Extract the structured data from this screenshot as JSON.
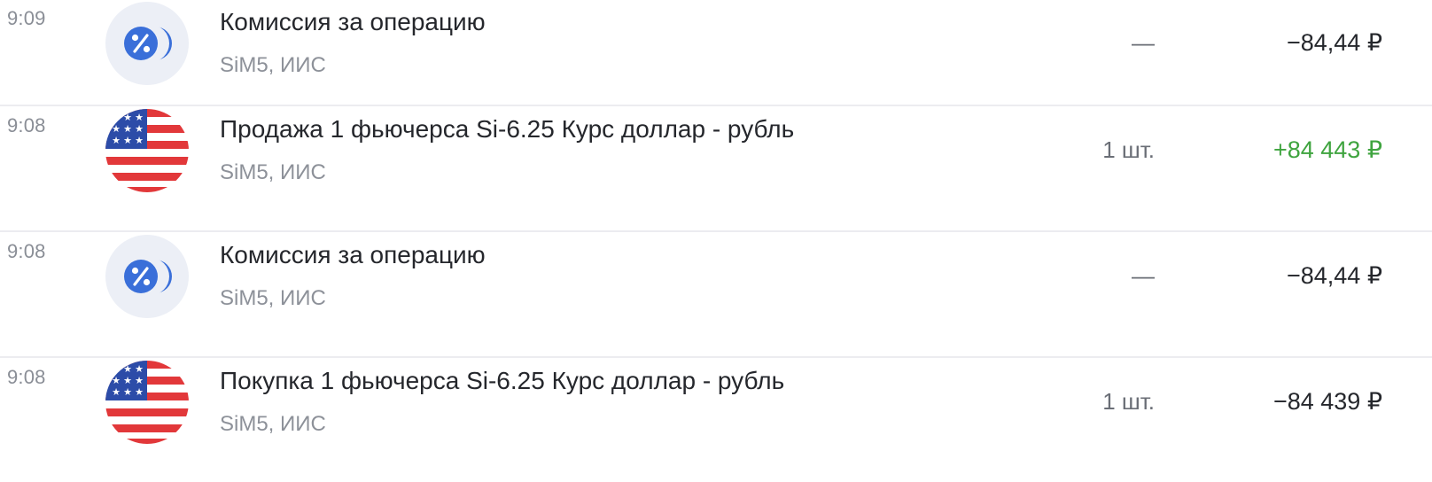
{
  "colors": {
    "positive_amount": "#3fa43f",
    "commission_icon": "#3a6fd9",
    "divider": "#ececf0"
  },
  "operations": [
    {
      "time": "9:09",
      "icon": "percent-coin-icon",
      "title": "Комиссия за операцию",
      "subtitle": "SiM5, ИИС",
      "quantity": "—",
      "amount": "−84,44 ₽"
    },
    {
      "time": "9:08",
      "icon": "us-flag-icon",
      "title": "Продажа 1 фьючерса Si-6.25 Курс доллар - рубль",
      "subtitle": "SiM5, ИИС",
      "quantity": "1 шт.",
      "amount": "+84 443 ₽"
    },
    {
      "time": "9:08",
      "icon": "percent-coin-icon",
      "title": "Комиссия за операцию",
      "subtitle": "SiM5, ИИС",
      "quantity": "—",
      "amount": "−84,44 ₽"
    },
    {
      "time": "9:08",
      "icon": "us-flag-icon",
      "title": "Покупка 1 фьючерса Si-6.25 Курс доллар - рубль",
      "subtitle": "SiM5, ИИС",
      "quantity": "1 шт.",
      "amount": "−84 439 ₽"
    }
  ]
}
